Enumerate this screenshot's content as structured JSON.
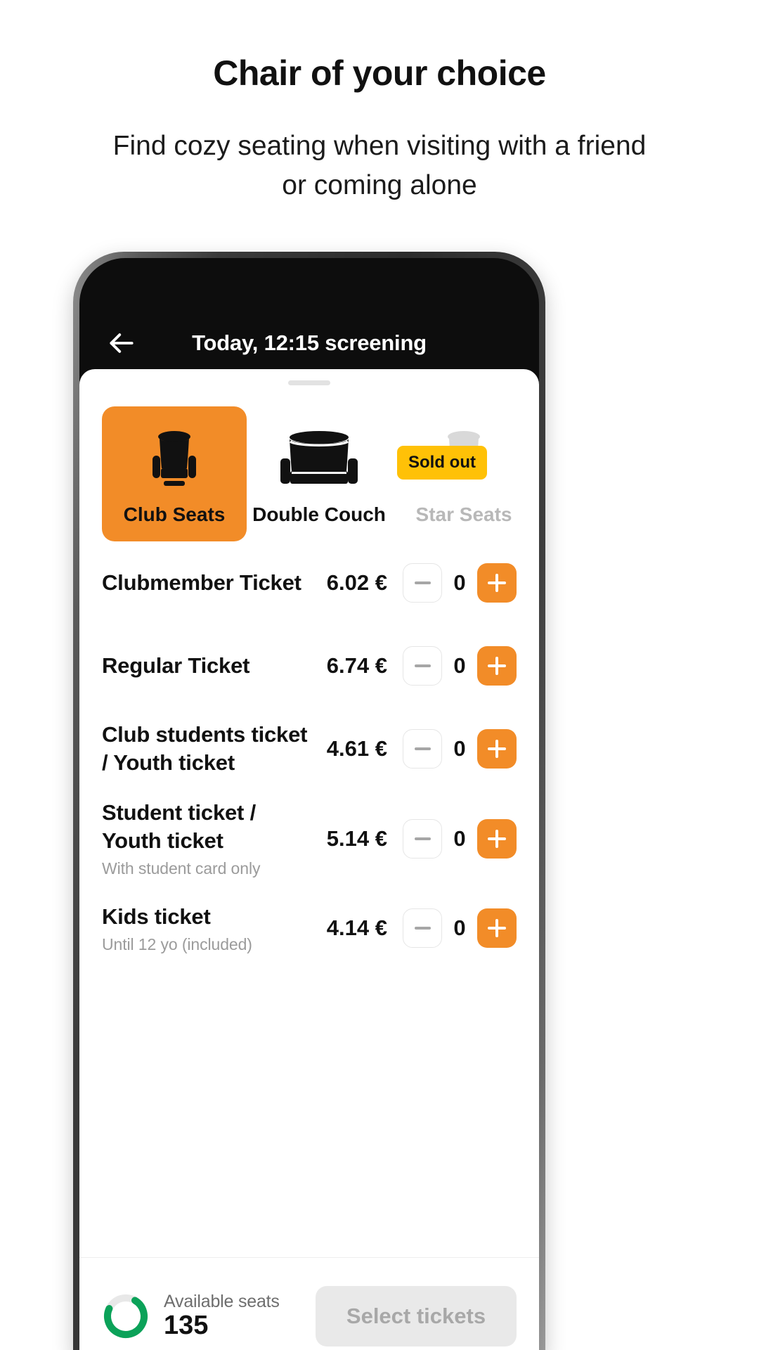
{
  "promo": {
    "title": "Chair of your choice",
    "subtitle": "Find cozy seating when visiting with a friend or coming alone"
  },
  "phone": {
    "navbar": {
      "back_icon": "arrow-left-icon",
      "title": "Today, 12:15 screening"
    },
    "sheet": {
      "seat_tabs": [
        {
          "label": "Club Seats",
          "icon": "club-seat-icon",
          "state": "selected",
          "badge": ""
        },
        {
          "label": "Double Couch",
          "icon": "double-couch-icon",
          "state": "default",
          "badge": ""
        },
        {
          "label": "Star Seats",
          "icon": "star-seat-icon",
          "state": "sold-out",
          "badge": "Sold out"
        }
      ],
      "tickets": [
        {
          "name": "Clubmember Ticket",
          "note": "",
          "price": "6.02 €",
          "count": "0"
        },
        {
          "name": "Regular Ticket",
          "note": "",
          "price": "6.74 €",
          "count": "0"
        },
        {
          "name": "Club students  ticket / Youth ticket",
          "note": "",
          "price": "4.61 €",
          "count": "0"
        },
        {
          "name": "Student ticket / Youth ticket",
          "note": "With student card only",
          "price": "5.14 €",
          "count": "0"
        },
        {
          "name": "Kids ticket",
          "note": "Until 12 yo (included)",
          "price": "4.14 €",
          "count": "0"
        }
      ],
      "footer": {
        "seats_label": "Available seats",
        "seats_count": "135",
        "select_button": "Select tickets",
        "ring_icon": "progress-ring-icon"
      }
    }
  },
  "colors": {
    "accent_orange": "#F28C28",
    "badge_yellow": "#FFC107",
    "ring_green": "#0BA259",
    "disabled_grey": "#e9e9e9"
  }
}
